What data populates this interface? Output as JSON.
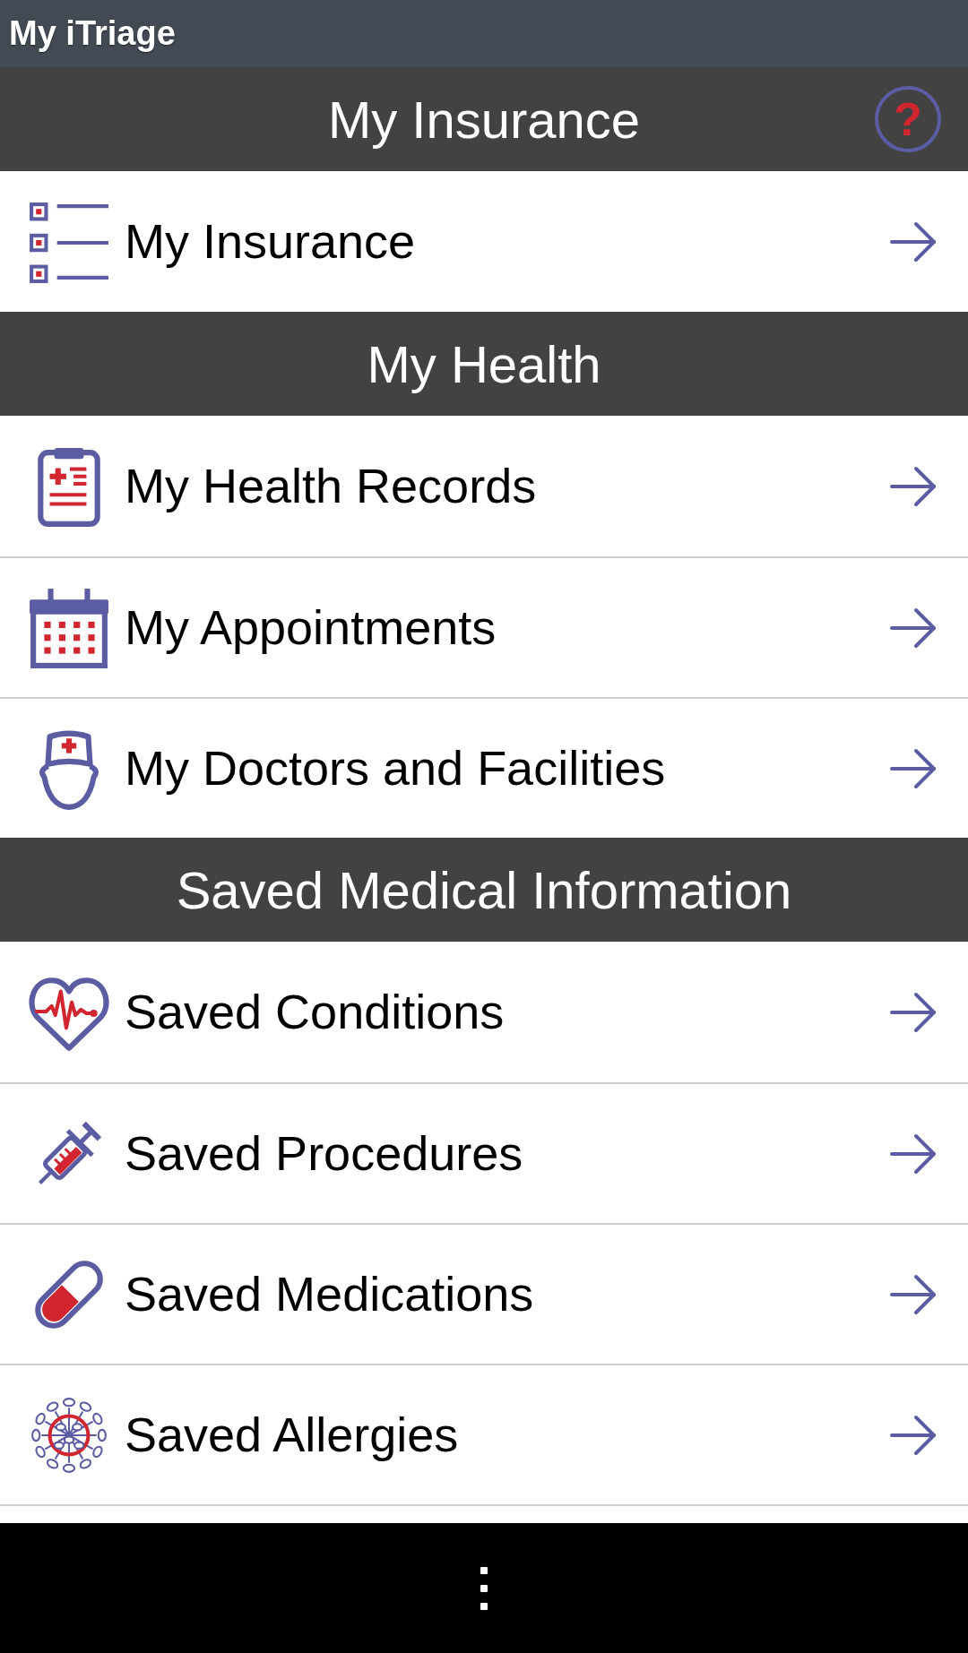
{
  "app_bar": {
    "title": "My iTriage"
  },
  "sections": [
    {
      "title": "My Insurance",
      "help": "?",
      "items": [
        {
          "label": "My Insurance"
        }
      ]
    },
    {
      "title": "My Health",
      "items": [
        {
          "label": "My Health Records"
        },
        {
          "label": "My Appointments"
        },
        {
          "label": "My Doctors and Facilities"
        }
      ]
    },
    {
      "title": "Saved Medical Information",
      "items": [
        {
          "label": "Saved Conditions"
        },
        {
          "label": "Saved Procedures"
        },
        {
          "label": "Saved Medications"
        },
        {
          "label": "Saved Allergies"
        }
      ]
    }
  ]
}
